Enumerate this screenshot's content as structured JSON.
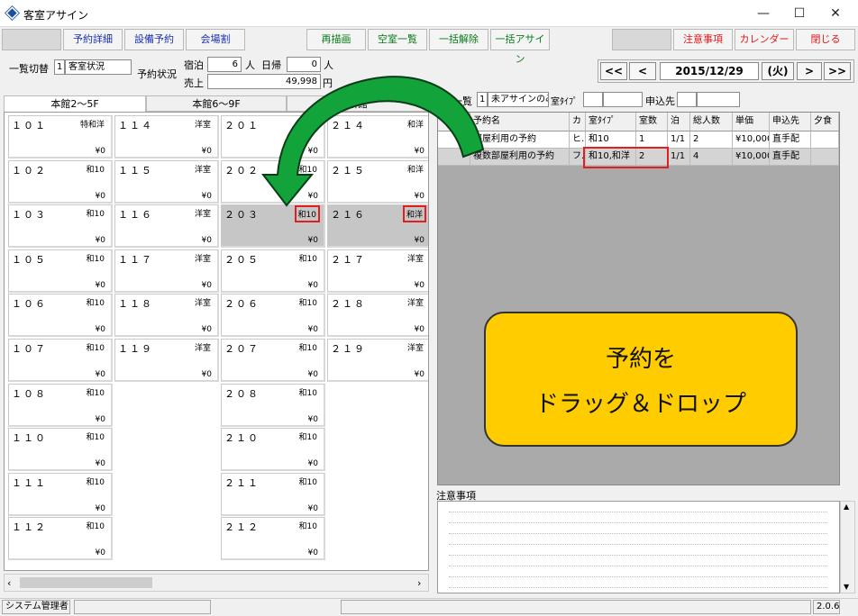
{
  "window": {
    "title": "客室アサイン"
  },
  "toolbar": {
    "btn1": "予約詳細",
    "btn2": "設備予約",
    "btn3": "会場割",
    "btn4": "再描画",
    "btn5": "空室一覧",
    "btn6": "一括解除",
    "btn7": "一括アサイン",
    "btn8": "注意事項",
    "btn9": "カレンダー",
    "btn10": "閉じる"
  },
  "info": {
    "list_switch_label": "一覧切替",
    "list_switch_no": "1",
    "list_switch_value": "客室状況",
    "status_label": "予約状況",
    "stay_label": "宿泊",
    "stay_val": "6",
    "person1": "人",
    "dayreturn_label": "日帰",
    "dayreturn_val": "0",
    "person2": "人",
    "sales_label": "売上",
    "sales_val": "49,998",
    "yen": "円"
  },
  "datenav": {
    "prev2": "<<",
    "prev": "<",
    "date": "2015/12/29",
    "dow": "(火)",
    "next": ">",
    "next2": ">>"
  },
  "tabs": [
    "本館2～5F",
    "本館6～9F",
    "新館"
  ],
  "rooms": [
    {
      "num": "１０１",
      "type": "特和洋",
      "price": "¥0"
    },
    {
      "num": "１０２",
      "type": "和10",
      "price": "¥0"
    },
    {
      "num": "１０３",
      "type": "和10",
      "price": "¥0"
    },
    {
      "num": "１０５",
      "type": "和10",
      "price": "¥0"
    },
    {
      "num": "１０６",
      "type": "和10",
      "price": "¥0"
    },
    {
      "num": "１０７",
      "type": "和10",
      "price": "¥0"
    },
    {
      "num": "１０８",
      "type": "和10",
      "price": "¥0"
    },
    {
      "num": "１１０",
      "type": "和10",
      "price": "¥0"
    },
    {
      "num": "１１１",
      "type": "和10",
      "price": "¥0"
    },
    {
      "num": "１１２",
      "type": "和10",
      "price": "¥0"
    },
    {
      "num": "１１４",
      "type": "洋室",
      "price": "¥0"
    },
    {
      "num": "１１５",
      "type": "洋室",
      "price": "¥0"
    },
    {
      "num": "１１６",
      "type": "洋室",
      "price": "¥0"
    },
    {
      "num": "１１７",
      "type": "洋室",
      "price": "¥0"
    },
    {
      "num": "１１８",
      "type": "洋室",
      "price": "¥0"
    },
    {
      "num": "１１９",
      "type": "洋室",
      "price": "¥0"
    },
    {
      "num": "２０１",
      "type": "和10",
      "price": "¥0"
    },
    {
      "num": "２０２",
      "type": "和10",
      "price": "¥0"
    },
    {
      "num": "２０３",
      "type": "和10",
      "price": "¥0"
    },
    {
      "num": "２０５",
      "type": "和10",
      "price": "¥0"
    },
    {
      "num": "２０６",
      "type": "和10",
      "price": "¥0"
    },
    {
      "num": "２０７",
      "type": "和10",
      "price": "¥0"
    },
    {
      "num": "２０８",
      "type": "和10",
      "price": "¥0"
    },
    {
      "num": "２１０",
      "type": "和10",
      "price": "¥0"
    },
    {
      "num": "２１１",
      "type": "和10",
      "price": "¥0"
    },
    {
      "num": "２１２",
      "type": "和10",
      "price": "¥0"
    },
    {
      "num": "２１４",
      "type": "和洋",
      "price": "¥0"
    },
    {
      "num": "２１５",
      "type": "和洋",
      "price": "¥0"
    },
    {
      "num": "２１６",
      "type": "和洋",
      "price": "¥0"
    },
    {
      "num": "２１７",
      "type": "洋室",
      "price": "¥0"
    },
    {
      "num": "２１８",
      "type": "洋室",
      "price": "¥0"
    },
    {
      "num": "２１９",
      "type": "洋室",
      "price": "¥0"
    }
  ],
  "rsvlist": {
    "label": "約一覧",
    "no": "1",
    "filter": "未アサインのみ",
    "roomtype_label": "室ﾀｲﾌﾟ",
    "roomtype_val": "",
    "apply_label": "申込先",
    "apply_val": "",
    "headers": [
      "予約名",
      "カ",
      "室ﾀｲﾌﾟ",
      "室数",
      "泊",
      "総人数",
      "単価",
      "申込先",
      "夕食"
    ],
    "rows": [
      [
        "部屋利用の予約",
        "ヒ…",
        "和10",
        "1",
        "1/1",
        "2",
        "¥10,000",
        "直手配",
        ""
      ],
      [
        "複数部屋利用の予約",
        "フ…",
        "和10,和洋",
        "2",
        "1/1",
        "4",
        "¥10,000",
        "直手配",
        ""
      ]
    ]
  },
  "callout": {
    "line1": "予約を",
    "line2": "ドラッグ＆ドロップ"
  },
  "notes": {
    "label": "注意事項"
  },
  "status": {
    "user": "システム管理者",
    "version": "2.0.6"
  }
}
